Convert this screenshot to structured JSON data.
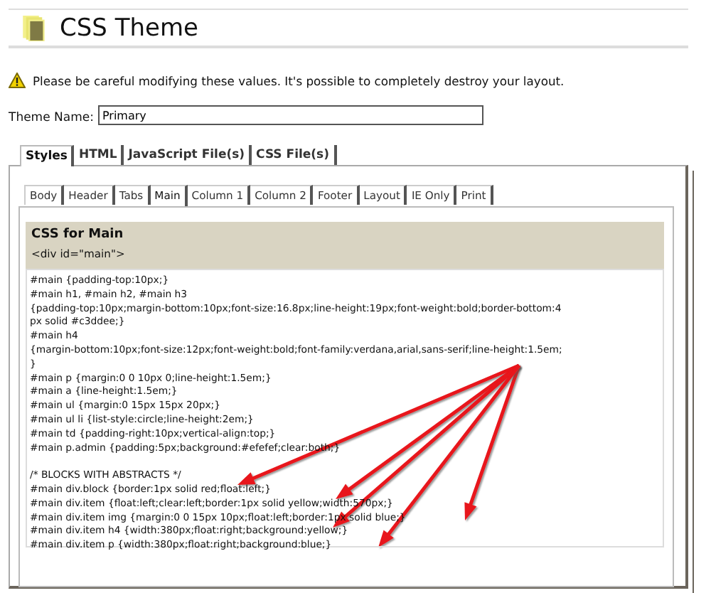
{
  "header": {
    "title": "CSS Theme"
  },
  "warning": "Please be careful modifying these values. It's possible to completely destroy your layout.",
  "theme_name": {
    "label": "Theme Name:",
    "value": "Primary"
  },
  "tabs": [
    {
      "label": "Styles",
      "selected": true
    },
    {
      "label": "HTML",
      "selected": false
    },
    {
      "label": "JavaScript File(s)",
      "selected": false
    },
    {
      "label": "CSS File(s)",
      "selected": false
    }
  ],
  "sub_tabs": [
    {
      "label": "Body",
      "selected": false
    },
    {
      "label": "Header",
      "selected": false
    },
    {
      "label": "Tabs",
      "selected": false
    },
    {
      "label": "Main",
      "selected": true
    },
    {
      "label": "Column 1",
      "selected": false
    },
    {
      "label": "Column 2",
      "selected": false
    },
    {
      "label": "Footer",
      "selected": false
    },
    {
      "label": "Layout",
      "selected": false
    },
    {
      "label": "IE Only",
      "selected": false
    },
    {
      "label": "Print",
      "selected": false
    }
  ],
  "section": {
    "title": "CSS for Main",
    "subtitle": "<div id=\"main\">"
  },
  "code_lines": [
    "#main {padding-top:10px;}",
    "#main h1, #main h2, #main h3",
    "{padding-top:10px;margin-bottom:10px;font-size:16.8px;line-height:19px;font-weight:bold;border-bottom:4",
    "px solid #c3ddee;}",
    "#main h4",
    "{margin-bottom:10px;font-size:12px;font-weight:bold;font-family:verdana,arial,sans-serif;line-height:1.5em;",
    "}",
    "#main p {margin:0 0 10px 0;line-height:1.5em;}",
    "#main a {line-height:1.5em;}",
    "#main ul {margin:0 15px 15px 20px;}",
    "#main ul li {list-style:circle;line-height:2em;}",
    "#main td {padding-right:10px;vertical-align:top;}",
    "#main p.admin {padding:5px;background:#efefef;clear:both;}"
  ],
  "code_lines_2": [
    "/* BLOCKS WITH ABSTRACTS */",
    "#main div.block {border:1px solid red;float:left;}",
    "#main div.item {float:left;clear:left;border:1px solid yellow;width:570px;}",
    "#main div.item img {margin:0 0 15px 10px;float:left;border:1px solid blue;}",
    "#main div.item h4 {width:380px;float:right;background:yellow;}",
    "#main div.item p {width:380px;float:right;background:blue;}"
  ]
}
